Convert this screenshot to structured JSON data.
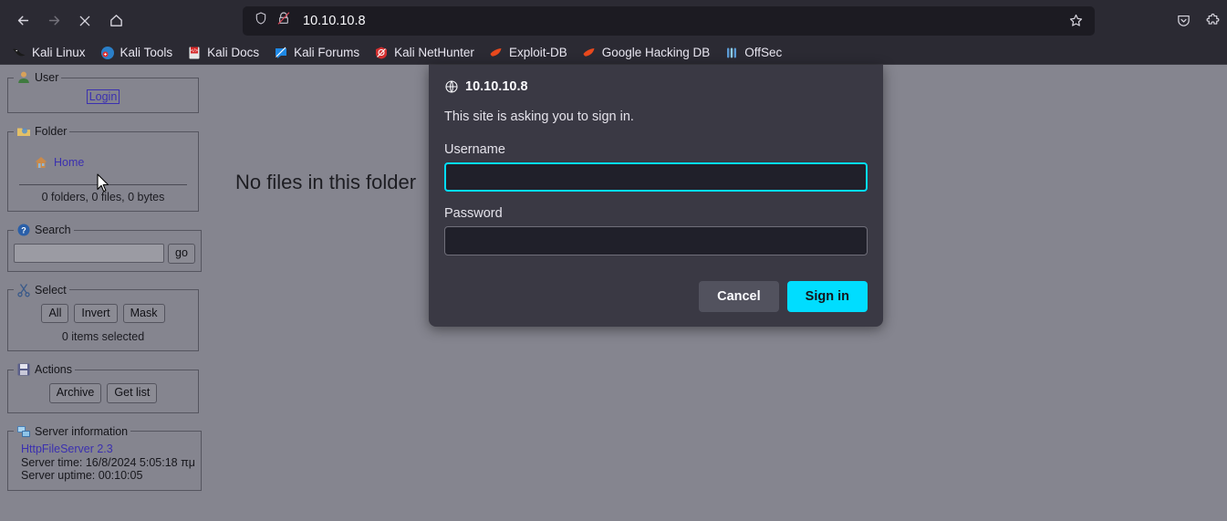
{
  "browser": {
    "nav": [
      {
        "name": "back-button",
        "icon": "arrow-left-icon",
        "enabled": true
      },
      {
        "name": "forward-button",
        "icon": "arrow-right-icon",
        "enabled": false
      },
      {
        "name": "stop-button",
        "icon": "close-x-icon",
        "enabled": true
      },
      {
        "name": "home-button",
        "icon": "home-icon",
        "enabled": true
      }
    ],
    "urlbar": {
      "shield_icon": "shield-icon",
      "lock_icon": "lock-crossed-out-icon",
      "url": "10.10.10.8",
      "star_icon": "bookmark-star-icon"
    },
    "right_icons": [
      {
        "name": "pocket-save-icon"
      },
      {
        "name": "extensions-puzzle-icon"
      }
    ],
    "bookmarks": [
      {
        "label": "Kali Linux",
        "icon": "kali-dragon-icon"
      },
      {
        "label": "Kali Tools",
        "icon": "kali-tools-icon"
      },
      {
        "label": "Kali Docs",
        "icon": "kali-docs-icon"
      },
      {
        "label": "Kali Forums",
        "icon": "kali-forums-icon"
      },
      {
        "label": "Kali NetHunter",
        "icon": "kali-nethunter-icon"
      },
      {
        "label": "Exploit-DB",
        "icon": "exploit-db-icon"
      },
      {
        "label": "Google Hacking DB",
        "icon": "google-hacking-db-icon"
      },
      {
        "label": "OffSec",
        "icon": "offsec-icon"
      }
    ]
  },
  "page": {
    "main_message": "No files in this folder",
    "sidebar": {
      "user": {
        "legend": "User",
        "legend_icon": "user-icon",
        "login_label": "Login"
      },
      "folder": {
        "legend": "Folder",
        "legend_icon": "folder-icon",
        "home_label": "Home",
        "home_icon": "house-icon",
        "stats": "0 folders, 0 files, 0 bytes"
      },
      "search": {
        "legend": "Search",
        "legend_icon": "help-question-icon",
        "input_value": "",
        "input_placeholder": "",
        "go_label": "go"
      },
      "select": {
        "legend": "Select",
        "legend_icon": "scissors-icon",
        "buttons": [
          "All",
          "Invert",
          "Mask"
        ],
        "status": "0 items selected"
      },
      "actions": {
        "legend": "Actions",
        "legend_icon": "floppy-disk-icon",
        "buttons": [
          "Archive",
          "Get list"
        ]
      },
      "server_information": {
        "legend": "Server information",
        "legend_icon": "server-computer-icon",
        "software_link": "HttpFileServer 2.3",
        "server_time": "Server time: 16/8/2024 5:05:18 πμ",
        "server_uptime": "Server uptime: 00:10:05"
      }
    }
  },
  "auth_dialog": {
    "title": "10.10.10.8",
    "title_icon": "globe-icon",
    "message": "This site is asking you to sign in.",
    "username_label": "Username",
    "username_value": "",
    "password_label": "Password",
    "password_value": "",
    "cancel_label": "Cancel",
    "signin_label": "Sign in"
  },
  "colors": {
    "chrome_bg": "#2b2a33",
    "urlbar_bg": "#1c1b22",
    "page_bg": "#85858f",
    "dialog_bg": "#3a3944",
    "accent_cyan": "#00ddff",
    "link_purple": "#3b30b0"
  }
}
